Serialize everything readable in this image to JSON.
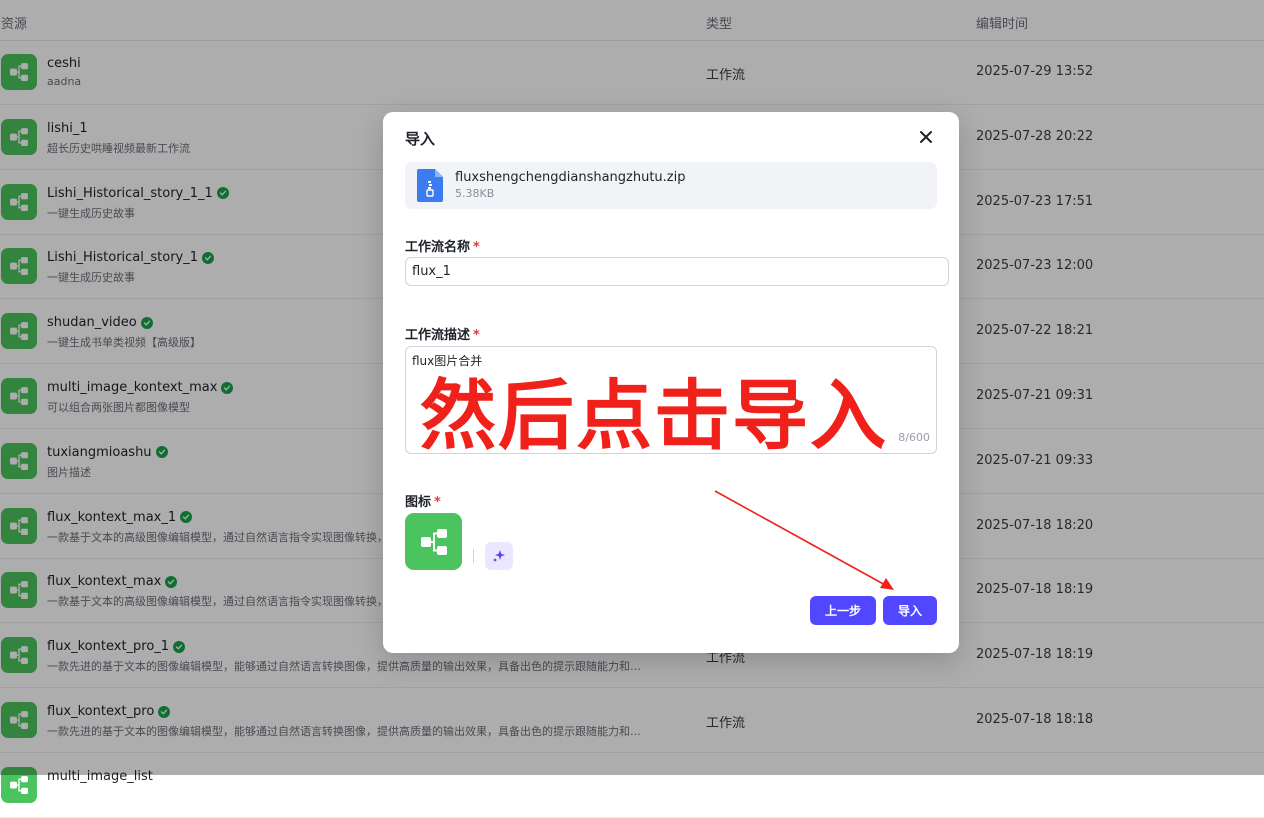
{
  "table": {
    "headers": {
      "resource": "资源",
      "type": "类型",
      "edited": "编辑时间"
    },
    "rows": [
      {
        "name": "ceshi",
        "desc": "aadna",
        "type": "工作流",
        "time": "2025-07-29 13:52",
        "verified": false
      },
      {
        "name": "lishi_1",
        "desc": "超长历史哄睡视频最新工作流",
        "type": "",
        "time": "2025-07-28 20:22",
        "verified": false
      },
      {
        "name": "Lishi_Historical_story_1_1",
        "desc": "一键生成历史故事",
        "type": "",
        "time": "2025-07-23 17:51",
        "verified": true
      },
      {
        "name": "Lishi_Historical_story_1",
        "desc": "一键生成历史故事",
        "type": "",
        "time": "2025-07-23 12:00",
        "verified": true
      },
      {
        "name": "shudan_video",
        "desc": "一键生成书单类视频【高级版】",
        "type": "",
        "time": "2025-07-22 18:21",
        "verified": true
      },
      {
        "name": "multi_image_kontext_max",
        "desc": "可以组合两张图片都图像模型",
        "type": "",
        "time": "2025-07-21 09:31",
        "verified": true
      },
      {
        "name": "tuxiangmioashu",
        "desc": "图片描述",
        "type": "",
        "time": "2025-07-21 09:33",
        "verified": true
      },
      {
        "name": "flux_kontext_max_1",
        "desc": "一款基于文本的高级图像编辑模型，通过自然语言指令实现图像转换，",
        "type": "",
        "time": "2025-07-18 18:20",
        "verified": true
      },
      {
        "name": "flux_kontext_max",
        "desc": "一款基于文本的高级图像编辑模型，通过自然语言指令实现图像转换，",
        "type": "",
        "time": "2025-07-18 18:19",
        "verified": true
      },
      {
        "name": "flux_kontext_pro_1",
        "desc": "一款先进的基于文本的图像编辑模型，能够通过自然语言转换图像，提供高质量的输出效果，具备出色的提示跟随能力和稳…",
        "type": "工作流",
        "time": "2025-07-18 18:19",
        "verified": true
      },
      {
        "name": "flux_kontext_pro",
        "desc": "一款先进的基于文本的图像编辑模型，能够通过自然语言转换图像，提供高质量的输出效果，具备出色的提示跟随能力和稳…",
        "type": "工作流",
        "time": "2025-07-18 18:18",
        "verified": true
      },
      {
        "name": "multi_image_list",
        "desc": "",
        "type": "",
        "time": "",
        "verified": false
      }
    ]
  },
  "modal": {
    "title": "导入",
    "file": {
      "name": "fluxshengchengdianshangzhutu.zip",
      "size": "5.38KB"
    },
    "name_label": "工作流名称",
    "name_value": "flux_1",
    "desc_label": "工作流描述",
    "desc_value": "flux图片合并",
    "desc_count": "8/600",
    "icon_label": "图标",
    "required_mark": "*",
    "prev_button": "上一步",
    "import_button": "导入"
  },
  "annotation": {
    "text": "然后点击导入",
    "color": "#f0201a"
  },
  "colors": {
    "accent": "#5147ff",
    "icon_green": "#4bc35e",
    "verified_green": "#1aa34a"
  }
}
